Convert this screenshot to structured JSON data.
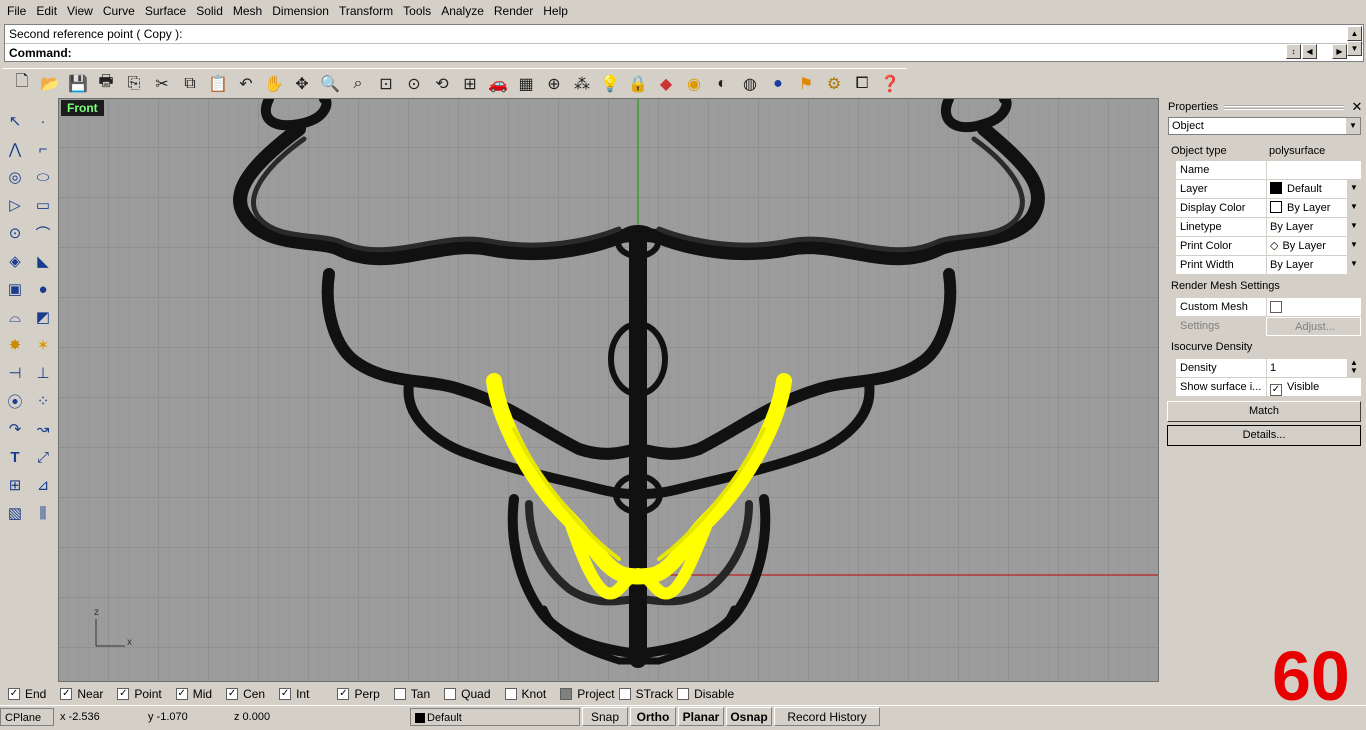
{
  "menu": [
    "File",
    "Edit",
    "View",
    "Curve",
    "Surface",
    "Solid",
    "Mesh",
    "Dimension",
    "Transform",
    "Tools",
    "Analyze",
    "Render",
    "Help"
  ],
  "command": {
    "history_line": "Second reference point ( Copy ):",
    "prompt_label": "Command:"
  },
  "viewport": {
    "name": "Front",
    "axis_z": "z",
    "axis_x": "x"
  },
  "properties": {
    "title": "Properties",
    "selector": "Object",
    "object_type_label": "Object type",
    "object_type_value": "polysurface",
    "rows": [
      {
        "label": "Name",
        "value": ""
      },
      {
        "label": "Layer",
        "value": "Default"
      },
      {
        "label": "Display Color",
        "value": "By Layer"
      },
      {
        "label": "Linetype",
        "value": "By Layer"
      },
      {
        "label": "Print Color",
        "value": "By Layer"
      },
      {
        "label": "Print Width",
        "value": "By Layer"
      }
    ],
    "render_mesh_section": "Render Mesh Settings",
    "custom_mesh_label": "Custom Mesh",
    "settings_label": "Settings",
    "adjust_button": "Adjust...",
    "isocurve_section": "Isocurve Density",
    "density_label": "Density",
    "density_value": "1",
    "show_surface_label": "Show surface i...",
    "visible_label": "Visible",
    "match_button": "Match",
    "details_button": "Details..."
  },
  "osnaps": [
    {
      "label": "End",
      "checked": true
    },
    {
      "label": "Near",
      "checked": true
    },
    {
      "label": "Point",
      "checked": true
    },
    {
      "label": "Mid",
      "checked": true
    },
    {
      "label": "Cen",
      "checked": true
    },
    {
      "label": "Int",
      "checked": true
    },
    {
      "label": "Perp",
      "checked": true
    },
    {
      "label": "Tan",
      "checked": false
    },
    {
      "label": "Quad",
      "checked": false
    },
    {
      "label": "Knot",
      "checked": false
    },
    {
      "label": "Project",
      "checked": false
    },
    {
      "label": "STrack",
      "checked": false
    },
    {
      "label": "Disable",
      "checked": false
    }
  ],
  "status": {
    "cplane": "CPlane",
    "x": "x -2.536",
    "y": "y -1.070",
    "z": "z 0.000",
    "layer": "Default",
    "snap": "Snap",
    "ortho": "Ortho",
    "planar": "Planar",
    "osnap": "Osnap",
    "record_history": "Record History"
  },
  "counter": "60",
  "colors": {
    "selected_object": "#ffff00",
    "x_axis": "#c00000",
    "y_axis": "#00a000",
    "viewport_bg": "#9c9c9c",
    "counter": "#e80000"
  }
}
